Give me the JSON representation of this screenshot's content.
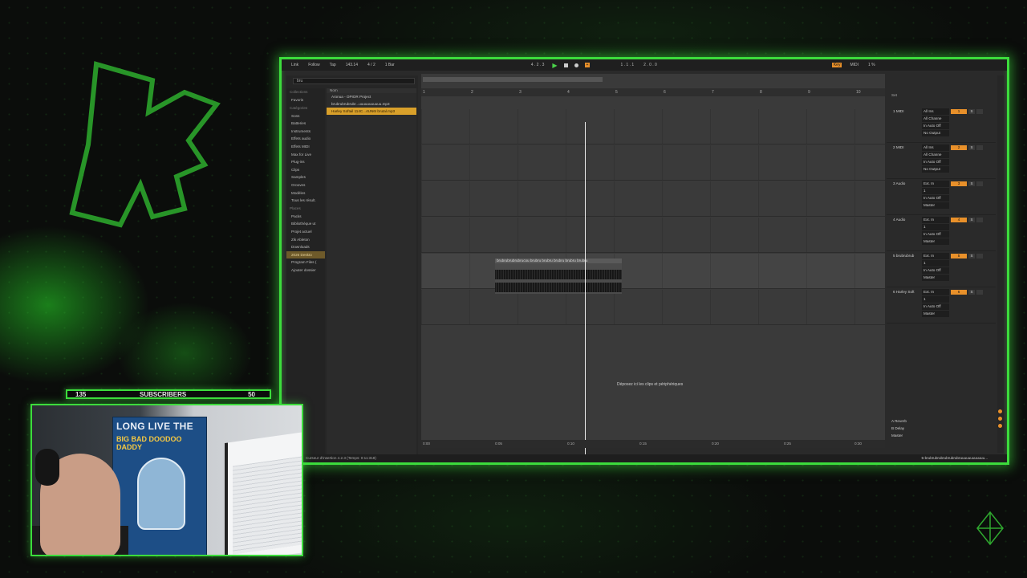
{
  "overlay": {
    "subscribers_label": "SUBSCRIBERS",
    "subscribers_left": "135",
    "subscribers_right": "50"
  },
  "daw": {
    "topbar": {
      "link": "Link",
      "follow": "Follow",
      "tap": "Tap",
      "tempo": "143.14",
      "signature": "4 / 2",
      "quantize": "1 Bar",
      "position": "4 . 2 . 3",
      "loop_start": "1 . 1 . 1",
      "loop_end": "2 . 0 . 0",
      "key": "Key",
      "midi": "MIDI",
      "cpu": "1 %"
    },
    "browser": {
      "search_value": "bru",
      "collections_header": "Collections",
      "collections": [
        "Favoris"
      ],
      "categories_header": "Catégories",
      "categories": [
        "Sons",
        "Batteries",
        "Instruments",
        "Effets audio",
        "Effets MIDI",
        "Max for Live",
        "Plug-ins",
        "Clips",
        "Samples",
        "Grooves",
        "Modèles",
        "Tous les résult."
      ],
      "places_header": "Places",
      "places": [
        "Packs",
        "Bibliothèque ut",
        "Projet actuel",
        "Zik Ableton",
        "Downloads",
        "2026 Deskto",
        "Program Files (",
        "Ajouter dossier"
      ],
      "files_header": "Nom",
      "files": [
        "Aronua - OPIOR Project",
        "brubrubrubrubr...uuuuuuuuuuu.mp3",
        "Harley Softail 114C...4UN6I brutal.mp3"
      ]
    },
    "ruler": [
      "1",
      "2",
      "3",
      "4",
      "5",
      "6",
      "7",
      "8",
      "9",
      "10"
    ],
    "clip_title": "brubrubrubrubrucou brubru brubru brubru brubru brubru",
    "drop_hint": "Déposez ici les clips et périphériques",
    "time_marks": [
      "0:00",
      "0:05",
      "0:10",
      "0:15",
      "0:20",
      "0:25",
      "0:30"
    ],
    "set_label": "Set",
    "tracks": [
      {
        "name": "1 MIDI",
        "input": "All Ins",
        "channel": "All Channe",
        "monitor": "In Auto Off",
        "output": "No Output",
        "num": "1"
      },
      {
        "name": "2 MIDI",
        "input": "All Ins",
        "channel": "All Channe",
        "monitor": "In Auto Off",
        "output": "No Output",
        "num": "2"
      },
      {
        "name": "3 Audio",
        "input": "Ext. In",
        "channel": "1",
        "monitor": "In Auto Off",
        "output": "Master",
        "num": "3"
      },
      {
        "name": "4 Audio",
        "input": "Ext. In",
        "channel": "1",
        "monitor": "In Auto Off",
        "output": "Master",
        "num": "4"
      },
      {
        "name": "5 brubrubrub",
        "input": "Ext. In",
        "channel": "1",
        "monitor": "In Auto Off",
        "output": "Master",
        "num": "5"
      },
      {
        "name": "6 Harley Soft",
        "input": "Ext. In",
        "channel": "1",
        "monitor": "In Auto Off",
        "output": "Master",
        "num": "6"
      }
    ],
    "returns": [
      "A Reverb",
      "B Delay",
      "Master"
    ],
    "status_left": "Curseur d'insertion 4.2.3 (Temps: 0:11:318)",
    "status_right": "5-brubrubrubrubrubrubruuuuuuuuuuuu..."
  },
  "colors": {
    "accent_green": "#3cdc3c",
    "ableton_orange": "#e8902a",
    "clip_gold": "#d9a02a"
  }
}
